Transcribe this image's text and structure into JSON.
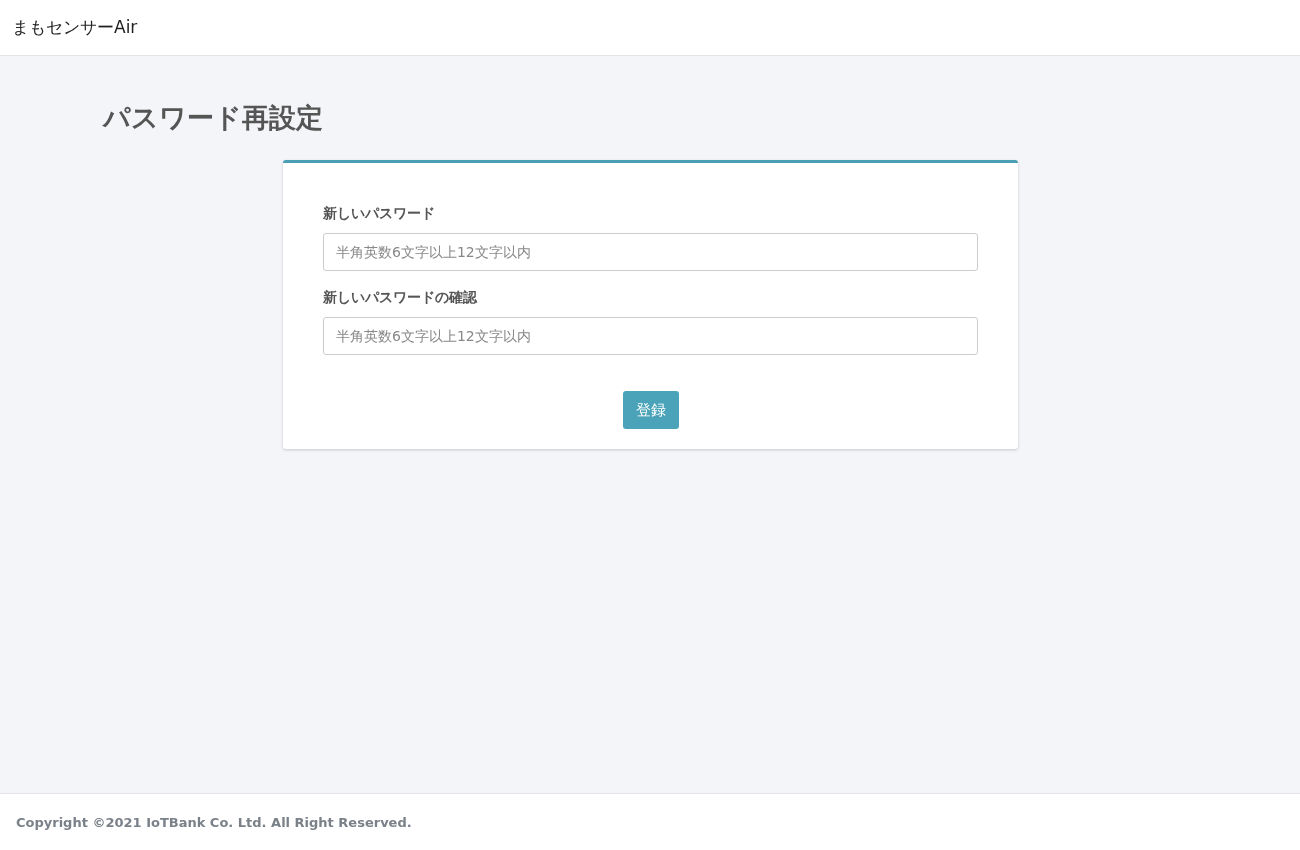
{
  "header": {
    "brand": "まもセンサーAir"
  },
  "page_title": "パスワード再設定",
  "form": {
    "fields": [
      {
        "label": "新しいパスワード",
        "placeholder": "半角英数6文字以上12文字以内"
      },
      {
        "label": "新しいパスワードの確認",
        "placeholder": "半角英数6文字以上12文字以内"
      }
    ],
    "submit": "登録"
  },
  "footer": {
    "copyright": "Copyright ©2021 IoTBank Co. Ltd. All Right Reserved."
  }
}
